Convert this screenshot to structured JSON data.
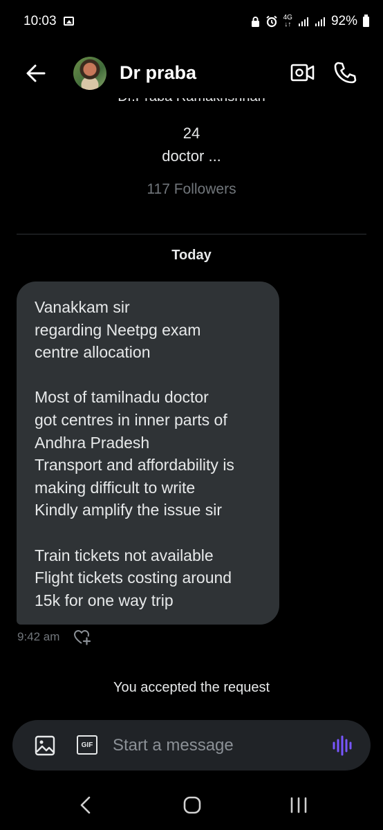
{
  "status_bar": {
    "time": "10:03",
    "battery": "92%",
    "network_label": "4G",
    "icons": [
      "image-icon",
      "lock-icon",
      "alarm-icon",
      "data-arrows-icon",
      "signal-icon",
      "signal-icon",
      "battery-icon"
    ]
  },
  "header": {
    "name": "Dr praba",
    "back_icon": "back-arrow-icon",
    "video_icon": "video-call-icon",
    "call_icon": "phone-icon"
  },
  "profile": {
    "partial_text": "Dr.Praba Ramakrishnan",
    "number": "24",
    "bio": "doctor ...",
    "followers": "117 Followers"
  },
  "conversation": {
    "date_label": "Today",
    "message": {
      "lines": [
        "Vanakkam sir",
        "regarding Neetpg exam",
        "centre allocation",
        "",
        "Most of tamilnadu doctor",
        "got centres in inner parts of",
        "Andhra Pradesh",
        "Transport and affordability is",
        "making difficult to write",
        "Kindly amplify the issue sir",
        "",
        "Train tickets not available",
        "Flight tickets costing around",
        "15k for one way trip"
      ],
      "time": "9:42 am"
    },
    "system_note": "You accepted the request"
  },
  "composer": {
    "placeholder": "Start a message",
    "gif_label": "GIF"
  },
  "colors": {
    "background": "#000000",
    "bubble": "#2f3336",
    "composer": "#202327",
    "muted_text": "#71767b",
    "voice_accent": "#7856ff"
  }
}
